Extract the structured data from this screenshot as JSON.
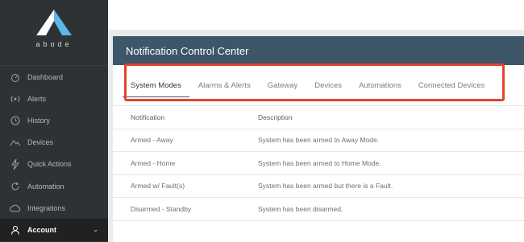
{
  "brand": {
    "name": "abode"
  },
  "sidebar": {
    "items": [
      {
        "label": "Dashboard",
        "icon": "dashboard-icon"
      },
      {
        "label": "Alerts",
        "icon": "alerts-icon"
      },
      {
        "label": "History",
        "icon": "history-icon"
      },
      {
        "label": "Devices",
        "icon": "devices-icon"
      },
      {
        "label": "Quick Actions",
        "icon": "quick-actions-icon"
      },
      {
        "label": "Automation",
        "icon": "automation-icon"
      },
      {
        "label": "Integrations",
        "icon": "integrations-icon"
      },
      {
        "label": "Account",
        "icon": "account-icon",
        "active": true
      }
    ]
  },
  "panel": {
    "title": "Notification Control Center",
    "tabs": [
      {
        "label": "System Modes",
        "active": true
      },
      {
        "label": "Alarms & Alerts"
      },
      {
        "label": "Gateway"
      },
      {
        "label": "Devices"
      },
      {
        "label": "Automations"
      },
      {
        "label": "Connected Devices"
      }
    ],
    "table": {
      "headers": [
        "Notification",
        "Description"
      ],
      "rows": [
        [
          "Armed - Away",
          "System has been armed to Away Mode."
        ],
        [
          "Armed - Home",
          "System has been armed to Home Mode."
        ],
        [
          "Armed w/ Fault(s)",
          "System has been armed but there is a Fault."
        ],
        [
          "Disarmed - Standby",
          "System has been disarmed."
        ]
      ]
    }
  },
  "colors": {
    "sidebar_bg": "#2f3234",
    "header_bg": "#3d5769",
    "highlight": "#e0452b",
    "logo_accent": "#5bb8e6"
  }
}
